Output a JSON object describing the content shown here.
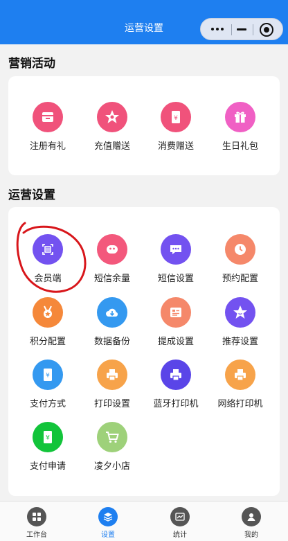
{
  "navbar": {
    "title": "运营设置",
    "capsule_more": "more-icon",
    "capsule_close": "target-icon"
  },
  "colors": {
    "navbar": "#1e7ff0",
    "tab_active": "#1e7ff0",
    "annotation": "#d8161b"
  },
  "marketing": {
    "title": "营销活动",
    "items": [
      {
        "label": "注册有礼",
        "icon": "register-gift-icon",
        "color": "#f0527b"
      },
      {
        "label": "充值赠送",
        "icon": "recharge-gift-icon",
        "color": "#f0527b"
      },
      {
        "label": "消费赠送",
        "icon": "consume-gift-icon",
        "color": "#f0527b"
      },
      {
        "label": "生日礼包",
        "icon": "birthday-gift-icon",
        "color": "#f060c4"
      }
    ]
  },
  "operations": {
    "title": "运营设置",
    "items": [
      {
        "label": "会员端",
        "icon": "member-client-icon",
        "color": "#7352f0"
      },
      {
        "label": "短信余量",
        "icon": "sms-balance-icon",
        "color": "#f3587c"
      },
      {
        "label": "短信设置",
        "icon": "sms-settings-icon",
        "color": "#7352f0"
      },
      {
        "label": "预约配置",
        "icon": "appointment-icon",
        "color": "#f5886a"
      },
      {
        "label": "积分配置",
        "icon": "points-medal-icon",
        "color": "#f5883a"
      },
      {
        "label": "数据备份",
        "icon": "cloud-download-icon",
        "color": "#3499f0"
      },
      {
        "label": "提成设置",
        "icon": "commission-icon",
        "color": "#f5886a"
      },
      {
        "label": "推荐设置",
        "icon": "recommend-star-icon",
        "color": "#7352f0"
      },
      {
        "label": "支付方式",
        "icon": "payment-method-icon",
        "color": "#3499f0"
      },
      {
        "label": "打印设置",
        "icon": "print-settings-icon",
        "color": "#f7a34a"
      },
      {
        "label": "蓝牙打印机",
        "icon": "bluetooth-printer-icon",
        "color": "#5a45e8"
      },
      {
        "label": "网络打印机",
        "icon": "network-printer-icon",
        "color": "#f7a34a"
      },
      {
        "label": "支付申请",
        "icon": "payment-apply-icon",
        "color": "#12c43a"
      },
      {
        "label": "凌夕小店",
        "icon": "shop-cart-icon",
        "color": "#9ed17a"
      }
    ]
  },
  "tabbar": {
    "items": [
      {
        "label": "工作台",
        "icon": "workbench-icon",
        "active": false
      },
      {
        "label": "设置",
        "icon": "settings-layers-icon",
        "active": true
      },
      {
        "label": "统计",
        "icon": "statistics-icon",
        "active": false
      },
      {
        "label": "我的",
        "icon": "profile-icon",
        "active": false
      }
    ]
  }
}
